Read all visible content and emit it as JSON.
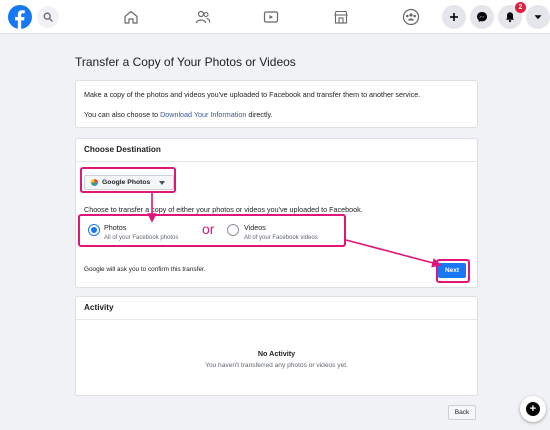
{
  "nav": {
    "icons": [
      "facebook-logo",
      "search-icon",
      "home-icon",
      "friends-icon",
      "watch-icon",
      "marketplace-icon",
      "groups-icon",
      "create-icon",
      "messenger-icon",
      "notifications-icon",
      "account-menu-icon"
    ],
    "notification_count": "2",
    "brand_color": "#1877f2"
  },
  "page": {
    "title": "Transfer a Copy of Your Photos or Videos"
  },
  "intro": {
    "line1": "Make a copy of the photos and videos you've uploaded to Facebook and transfer them to another service.",
    "line2_prefix": "You can also choose to ",
    "line2_link": "Download Your Information",
    "line2_suffix": " directly."
  },
  "destination": {
    "heading": "Choose Destination",
    "selected": "Google Photos",
    "choose_text": "Choose to transfer a copy of either your photos or videos you've uploaded to Facebook.",
    "options": [
      {
        "label": "Photos",
        "sub": "All of your Facebook photos",
        "checked": true
      },
      {
        "label": "Videos",
        "sub": "All of your Facebook videos",
        "checked": false
      }
    ],
    "confirm_text": "Google will ask you to confirm this transfer.",
    "next_label": "Next"
  },
  "annotation": {
    "or_text": "or",
    "color": "#e0157a"
  },
  "activity": {
    "heading": "Activity",
    "empty_title": "No Activity",
    "empty_sub": "You haven't transferred any photos or videos yet."
  },
  "footer": {
    "back_label": "Back"
  }
}
